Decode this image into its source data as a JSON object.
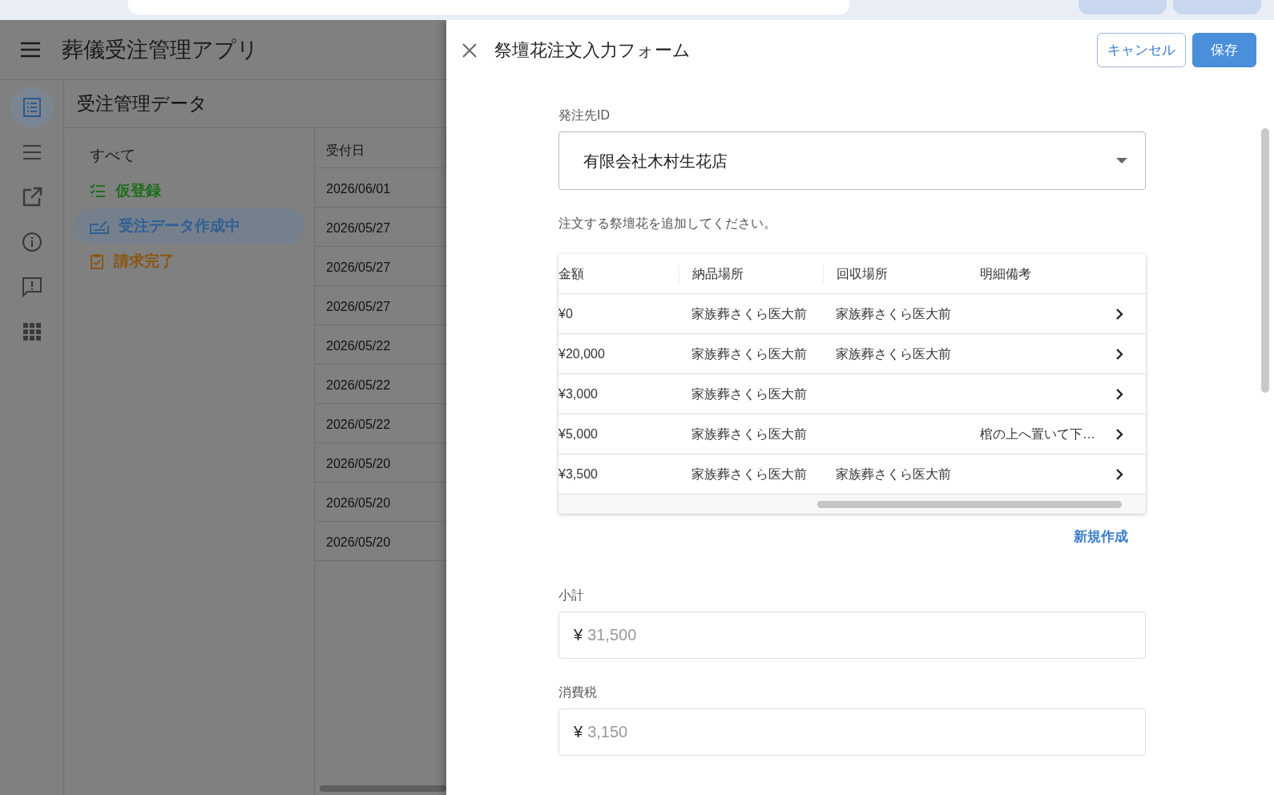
{
  "app": {
    "title": "葬儀受注管理アプリ",
    "rail": [
      {
        "kind": "list",
        "selected": true
      },
      {
        "kind": "menu",
        "selected": false
      },
      {
        "kind": "open",
        "selected": false
      },
      {
        "kind": "info",
        "selected": false
      },
      {
        "kind": "feedback",
        "selected": false
      },
      {
        "kind": "apps",
        "selected": false
      }
    ],
    "section_title": "受注管理データ",
    "filters": [
      {
        "label": "すべて",
        "kind": "all",
        "color": "#1a1a1a",
        "selected": false
      },
      {
        "label": "仮登録",
        "kind": "draft",
        "color": "#1c6e1c",
        "selected": false
      },
      {
        "label": "受注データ作成中",
        "kind": "progress",
        "color": "#2f5f93",
        "selected": true
      },
      {
        "label": "請求完了",
        "kind": "billed",
        "color": "#8a5612",
        "selected": false
      }
    ],
    "table": {
      "columns": [
        "受付日"
      ],
      "rows": [
        [
          "2026/06/01"
        ],
        [
          "2026/05/27"
        ],
        [
          "2026/05/27"
        ],
        [
          "2026/05/27"
        ],
        [
          "2026/05/22"
        ],
        [
          "2026/05/22"
        ],
        [
          "2026/05/22"
        ],
        [
          "2026/05/20"
        ],
        [
          "2026/05/20"
        ],
        [
          "2026/05/20"
        ]
      ]
    }
  },
  "form": {
    "title": "祭壇花注文入力フォーム",
    "buttons": [
      {
        "label": "キャンセル",
        "kind": "outline"
      },
      {
        "label": "保存",
        "kind": "primary"
      }
    ],
    "supplier": {
      "label": "発注先ID",
      "value": "有限会社木村生花店"
    },
    "helper": "注文する祭壇花を追加してください。",
    "items": {
      "columns": [
        "金額",
        "納品場所",
        "回収場所",
        "明細備考"
      ],
      "rows": [
        {
          "cells": [
            "¥0",
            "家族葬さくら医大前",
            "家族葬さくら医大前",
            ""
          ]
        },
        {
          "cells": [
            "¥20,000",
            "家族葬さくら医大前",
            "家族葬さくら医大前",
            ""
          ]
        },
        {
          "cells": [
            "¥3,000",
            "家族葬さくら医大前",
            "",
            ""
          ]
        },
        {
          "cells": [
            "¥5,000",
            "家族葬さくら医大前",
            "",
            "棺の上へ置いて下…"
          ]
        },
        {
          "cells": [
            "¥3,500",
            "家族葬さくら医大前",
            "家族葬さくら医大前",
            ""
          ]
        }
      ]
    },
    "add_link": "新規作成",
    "fields": [
      {
        "label": "小計",
        "prefix": "¥",
        "value": "31,500",
        "disabled": true
      },
      {
        "label": "消費税",
        "prefix": "¥",
        "value": "3,150",
        "disabled": true
      }
    ]
  }
}
